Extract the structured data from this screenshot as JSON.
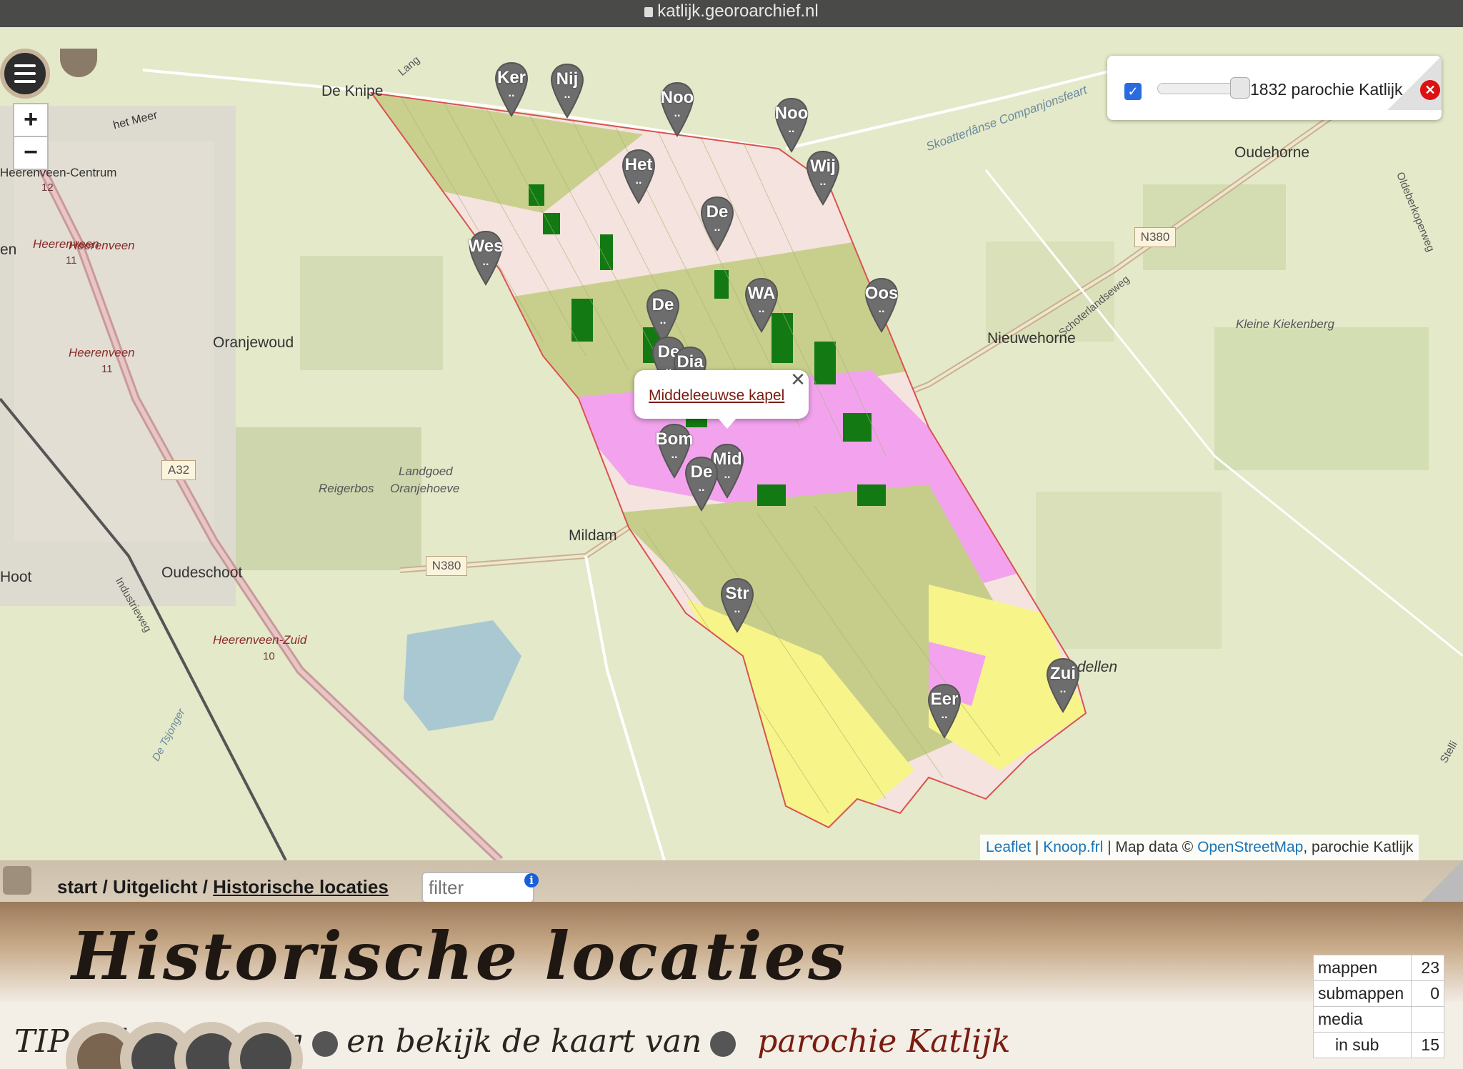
{
  "browser": {
    "url": "katlijk.georoarchief.nl"
  },
  "map": {
    "zoom_in": "+",
    "zoom_out": "−",
    "place_labels": [
      "De Knipe",
      "Oudehorne",
      "Nieuwehorne",
      "Oranjewoud",
      "Heerenveen",
      "Heerenveen",
      "Oudeschoot",
      "Mildam",
      "Landgoed",
      "Oranjehoeve",
      "Reigerbos",
      "Kleine Kiekenberg",
      "het Meer",
      "Skoatterlânse Companjonsfeart",
      "Schoterlandseweg",
      "Oldeberkoperweg",
      "Industrieweg",
      "De Tsjonger",
      "Heerenveen-Centrum",
      "Heerenveen-Zuid",
      "Heerenveen",
      "Lang",
      "Hoot",
      "en",
      "dellen",
      "Stelli"
    ],
    "road_numbers": [
      "12",
      "11",
      "11",
      "10"
    ],
    "road_labels": [
      "N380",
      "N380",
      "A32"
    ],
    "markers": [
      {
        "label": "Ker",
        "sub": ".."
      },
      {
        "label": "Nij",
        "sub": ".."
      },
      {
        "label": "Noo",
        "sub": ".."
      },
      {
        "label": "Noo",
        "sub": ".."
      },
      {
        "label": "Het",
        "sub": ".."
      },
      {
        "label": "Wij",
        "sub": ".."
      },
      {
        "label": "De",
        "sub": ".."
      },
      {
        "label": "Wes",
        "sub": ".."
      },
      {
        "label": "WA",
        "sub": ".."
      },
      {
        "label": "Oos",
        "sub": ".."
      },
      {
        "label": "De",
        "sub": ".."
      },
      {
        "label": "De",
        "sub": ".."
      },
      {
        "label": "Dia",
        "sub": ".."
      },
      {
        "label": "Bom",
        "sub": ".."
      },
      {
        "label": "Mid",
        "sub": ".."
      },
      {
        "label": "De",
        "sub": ".."
      },
      {
        "label": "Str",
        "sub": ".."
      },
      {
        "label": "Eer",
        "sub": ".."
      },
      {
        "label": "Zui",
        "sub": ".."
      }
    ],
    "popup": {
      "link": "Middeleeuwse kapel",
      "close": "✕"
    },
    "attribution": {
      "leaflet": "Leaflet",
      "sep1": " | ",
      "knoop": "Knoop.frl",
      "sep2": " | Map data © ",
      "osm": "OpenStreetMap",
      "tail": ", parochie Katlijk"
    }
  },
  "layer_control": {
    "label": "1832 parochie Katlijk",
    "remove": "✕",
    "check": "✓"
  },
  "panel": {
    "breadcrumb": {
      "start": "start",
      "sep1": " / ",
      "uitgelicht": "Uitgelicht",
      "sep2": " / ",
      "current": "Historische locaties"
    },
    "filter_placeholder": "filter",
    "info": "i",
    "title": "Historische locaties",
    "intro_start": "TIP klik rechts via",
    "intro_mid": "en bekijk de kaart van",
    "parochie": "parochie Katlijk",
    "stats": [
      {
        "label": "mappen",
        "value": "23"
      },
      {
        "label": "submappen",
        "value": "0"
      },
      {
        "label": "media",
        "value": ""
      },
      {
        "label": "in sub",
        "value": "15"
      }
    ]
  },
  "colors": {
    "accent": "#7a1c10",
    "link": "#1a74b8",
    "marker": "#6d6d6d",
    "pink": "#f4a6ef",
    "yellow": "#f7f58a",
    "olive": "#cfd49a",
    "green": "#1e7f1e"
  }
}
